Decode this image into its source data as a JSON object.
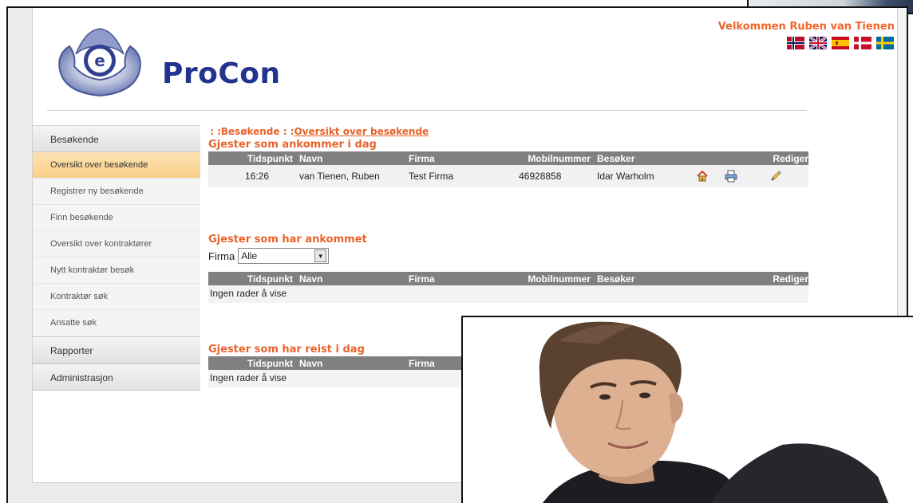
{
  "header": {
    "logo_text": "ProCon",
    "welcome": "Velkommen Ruben van Tienen",
    "languages": [
      "norwegian-flag",
      "uk-flag",
      "spanish-flag",
      "danish-flag",
      "swedish-flag"
    ]
  },
  "sidebar": {
    "sections": [
      {
        "label": "Besøkende",
        "items": [
          {
            "label": "Oversikt over besøkende",
            "active": true
          },
          {
            "label": "Registrer ny besøkende"
          },
          {
            "label": "Finn besøkende"
          },
          {
            "label": "Oversikt over kontraktører"
          },
          {
            "label": "Nytt kontraktør besøk"
          },
          {
            "label": "Kontraktør søk"
          },
          {
            "label": "Ansatte søk"
          }
        ]
      },
      {
        "label": "Rapporter"
      },
      {
        "label": "Administrasjon"
      }
    ]
  },
  "breadcrumb": {
    "prefix": ": :Besøkende : :",
    "current": "Oversikt over besøkende"
  },
  "columns": [
    "Tidspunkt",
    "Navn",
    "Firma",
    "Mobilnummer",
    "Besøker",
    "Rediger"
  ],
  "arriving": {
    "title": "Gjester som ankommer i dag",
    "rows": [
      {
        "tidspunkt": "16:26",
        "navn": "van Tienen, Ruben",
        "firma": "Test Firma",
        "mobil": "46928858",
        "besoker": "Idar Warholm"
      }
    ]
  },
  "arrived": {
    "title": "Gjester som har ankommet",
    "filter_label": "Firma",
    "filter_value": "Alle",
    "empty": "Ingen rader å vise"
  },
  "departed": {
    "title": "Gjester som har reist i dag",
    "empty": "Ingen rader å vise"
  },
  "colors": {
    "accent": "#e8632b",
    "brand": "#23348e",
    "table_header": "#808080",
    "active_menu": "#f9cf85"
  }
}
